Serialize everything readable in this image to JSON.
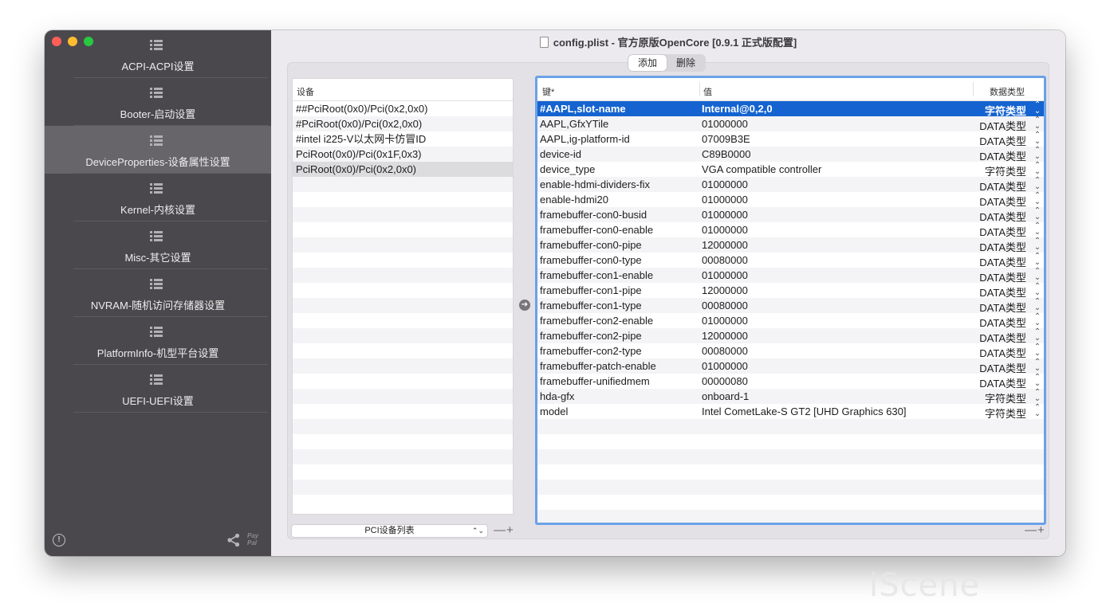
{
  "window": {
    "title": "config.plist - 官方原版OpenCore [0.9.1 正式版配置]"
  },
  "sidebar": {
    "items": [
      {
        "label": "ACPI-ACPI设置",
        "active": false
      },
      {
        "label": "Booter-启动设置",
        "active": false
      },
      {
        "label": "DeviceProperties-设备属性设置",
        "active": true
      },
      {
        "label": "Kernel-内核设置",
        "active": false
      },
      {
        "label": "Misc-其它设置",
        "active": false
      },
      {
        "label": "NVRAM-随机访问存储器设置",
        "active": false
      },
      {
        "label": "PlatformInfo-机型平台设置",
        "active": false
      },
      {
        "label": "UEFI-UEFI设置",
        "active": false
      }
    ],
    "info_icon": "info-icon",
    "share_icon": "share-icon",
    "paypal_top": "Pay",
    "paypal_bottom": "Pal"
  },
  "segment": {
    "add": "添加",
    "delete": "删除",
    "selected": "add"
  },
  "devices": {
    "header": "设备",
    "rows": [
      "##PciRoot(0x0)/Pci(0x2,0x0)",
      "#PciRoot(0x0)/Pci(0x2,0x0)",
      "#intel i225-V以太网卡仿冒ID",
      "PciRoot(0x0)/Pci(0x1F,0x3)",
      "PciRoot(0x0)/Pci(0x2,0x0)"
    ],
    "selected_index": 4,
    "bottom_select": "PCI设备列表",
    "minus": "—",
    "plus": "+"
  },
  "entries": {
    "header_key": "键*",
    "header_value": "值",
    "header_type": "数据类型",
    "rows": [
      {
        "key": "#AAPL,slot-name",
        "value": "Internal@0,2,0",
        "type": "字符类型"
      },
      {
        "key": "AAPL,GfxYTile",
        "value": "01000000",
        "type": "DATA类型"
      },
      {
        "key": "AAPL,ig-platform-id",
        "value": "07009B3E",
        "type": "DATA类型"
      },
      {
        "key": "device-id",
        "value": "C89B0000",
        "type": "DATA类型"
      },
      {
        "key": "device_type",
        "value": "VGA compatible controller",
        "type": "字符类型"
      },
      {
        "key": "enable-hdmi-dividers-fix",
        "value": "01000000",
        "type": "DATA类型"
      },
      {
        "key": "enable-hdmi20",
        "value": "01000000",
        "type": "DATA类型"
      },
      {
        "key": "framebuffer-con0-busid",
        "value": "01000000",
        "type": "DATA类型"
      },
      {
        "key": "framebuffer-con0-enable",
        "value": "01000000",
        "type": "DATA类型"
      },
      {
        "key": "framebuffer-con0-pipe",
        "value": "12000000",
        "type": "DATA类型"
      },
      {
        "key": "framebuffer-con0-type",
        "value": "00080000",
        "type": "DATA类型"
      },
      {
        "key": "framebuffer-con1-enable",
        "value": "01000000",
        "type": "DATA类型"
      },
      {
        "key": "framebuffer-con1-pipe",
        "value": "12000000",
        "type": "DATA类型"
      },
      {
        "key": "framebuffer-con1-type",
        "value": "00080000",
        "type": "DATA类型"
      },
      {
        "key": "framebuffer-con2-enable",
        "value": "01000000",
        "type": "DATA类型"
      },
      {
        "key": "framebuffer-con2-pipe",
        "value": "12000000",
        "type": "DATA类型"
      },
      {
        "key": "framebuffer-con2-type",
        "value": "00080000",
        "type": "DATA类型"
      },
      {
        "key": "framebuffer-patch-enable",
        "value": "01000000",
        "type": "DATA类型"
      },
      {
        "key": "framebuffer-unifiedmem",
        "value": "00000080",
        "type": "DATA类型"
      },
      {
        "key": "hda-gfx",
        "value": "onboard-1",
        "type": "字符类型"
      },
      {
        "key": "model",
        "value": "Intel CometLake-S GT2 [UHD Graphics 630]",
        "type": "字符类型"
      }
    ],
    "selected_index": 0,
    "minus": "—",
    "plus": "+"
  },
  "watermark": "iScene",
  "colors": {
    "sidebar_bg": "#4b484d",
    "sidebar_active": "#67646a",
    "selection_blue": "#1463d0",
    "focus_ring": "#6aa1e8"
  }
}
